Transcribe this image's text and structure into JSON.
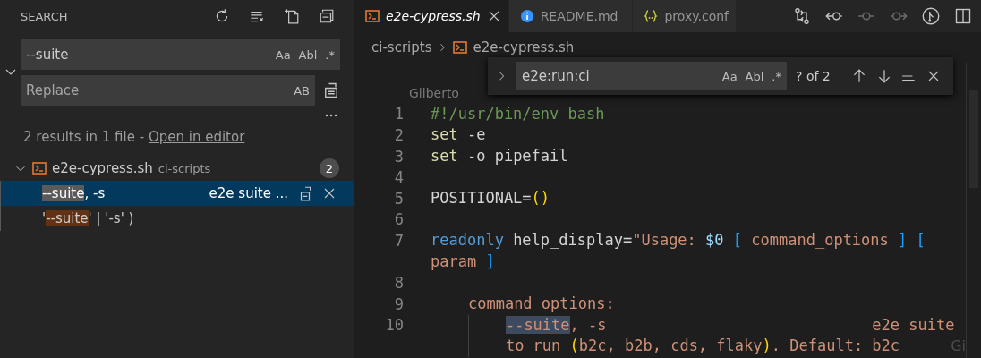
{
  "sidebar": {
    "title": "SEARCH",
    "search": {
      "value": "--suite",
      "toggles": [
        "Aa",
        "Abl",
        ".*"
      ]
    },
    "replace": {
      "placeholder": "Replace",
      "toggles": [
        "AB"
      ]
    },
    "expanded": true,
    "summary": "2 results in 1 file - ",
    "summary_link": "Open in editor",
    "files": [
      {
        "name": "e2e-cypress.sh",
        "folder": "ci-scripts",
        "count": "2",
        "expanded": true,
        "matches": [
          {
            "match": "--suite",
            "after": ", -s",
            "context": "e2e suite ...",
            "selected": true
          },
          {
            "before": "'",
            "match": "--suite",
            "after": "' | '-s' )",
            "selected": false
          }
        ]
      }
    ]
  },
  "tabs": [
    {
      "label": "e2e-cypress.sh",
      "kind": "shell",
      "selected": true
    },
    {
      "label": "README.md",
      "kind": "info",
      "selected": false
    },
    {
      "label": "proxy.conf",
      "kind": "json",
      "selected": false
    }
  ],
  "breadcrumb": [
    {
      "label": "ci-scripts",
      "kind": "folder"
    },
    {
      "label": "e2e-cypress.sh",
      "kind": "shell"
    }
  ],
  "find": {
    "value": "e2e:run:ci",
    "toggles": [
      "Aa",
      "Abl",
      ".*"
    ],
    "count": "? of 2"
  },
  "blame": "Gilberto",
  "ghost_blame": "Gi",
  "code": [
    {
      "number": "1",
      "tokens": [
        {
          "kind": "comment",
          "text": "#!/usr/bin/env bash"
        }
      ]
    },
    {
      "number": "2",
      "tokens": [
        {
          "kind": "builtin",
          "text": "set"
        },
        {
          "kind": "plain",
          "text": " -e"
        }
      ]
    },
    {
      "number": "3",
      "tokens": [
        {
          "kind": "builtin",
          "text": "set"
        },
        {
          "kind": "plain",
          "text": " -o pipefail"
        }
      ]
    },
    {
      "number": "4"
    },
    {
      "number": "5",
      "tokens": [
        {
          "kind": "plain",
          "text": "POSITIONAL="
        },
        {
          "kind": "paren",
          "text": "()"
        }
      ]
    },
    {
      "number": "6"
    },
    {
      "number": "7",
      "tokens": [
        {
          "kind": "keyword",
          "text": "readonly"
        },
        {
          "kind": "plain",
          "text": " help_display="
        },
        {
          "kind": "string",
          "text": "\"Usage: "
        },
        {
          "kind": "variable",
          "text": "$0 "
        },
        {
          "kind": "bracket",
          "text": "["
        },
        {
          "kind": "string",
          "text": " command_options "
        },
        {
          "kind": "bracket",
          "text": "] ["
        }
      ]
    },
    {
      "tokens": [
        {
          "kind": "string",
          "text": "param "
        },
        {
          "kind": "bracket",
          "text": "]"
        }
      ]
    },
    {
      "number": "8"
    },
    {
      "number": "9",
      "tokens": [
        {
          "kind": "string",
          "text": "    command options:"
        }
      ]
    },
    {
      "number": "10",
      "tokens": [
        {
          "kind": "match",
          "text": "        --suite"
        },
        {
          "kind": "string",
          "text": ", -s                             e2e suite"
        }
      ]
    },
    {
      "tokens": [
        {
          "kind": "string",
          "text": "        to run "
        },
        {
          "kind": "paren",
          "text": "("
        },
        {
          "kind": "string",
          "text": "b2c, b2b, cds, flaky"
        },
        {
          "kind": "paren",
          "text": ")"
        },
        {
          "kind": "string",
          "text": ". Default: b2c"
        }
      ]
    }
  ]
}
